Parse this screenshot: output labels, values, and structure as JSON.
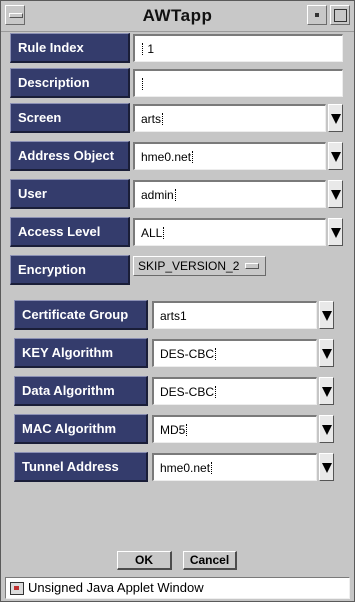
{
  "window": {
    "title": "AWTapp"
  },
  "form": {
    "rows": [
      {
        "label": "Rule Index",
        "value": "1",
        "kind": "text"
      },
      {
        "label": "Description",
        "value": "",
        "kind": "text"
      },
      {
        "label": "Screen",
        "value": "arts",
        "kind": "combo"
      },
      {
        "label": "Address Object",
        "value": "hme0.net",
        "kind": "combo"
      },
      {
        "label": "User",
        "value": "admin",
        "kind": "combo"
      },
      {
        "label": "Access Level",
        "value": "ALL",
        "kind": "combo"
      },
      {
        "label": "Encryption",
        "value": "SKIP_VERSION_2",
        "kind": "option"
      }
    ],
    "sub_rows": [
      {
        "label": "Certificate Group",
        "value": "arts1"
      },
      {
        "label": "KEY Algorithm",
        "value": "DES-CBC"
      },
      {
        "label": "Data Algorithm",
        "value": "DES-CBC"
      },
      {
        "label": "MAC Algorithm",
        "value": "MD5"
      },
      {
        "label": "Tunnel Address",
        "value": "hme0.net"
      }
    ]
  },
  "buttons": {
    "ok": "OK",
    "cancel": "Cancel"
  },
  "status": {
    "text": "Unsigned Java Applet Window"
  },
  "colors": {
    "label_bg": "#343c6c",
    "window_bg": "#c6c6c6"
  }
}
